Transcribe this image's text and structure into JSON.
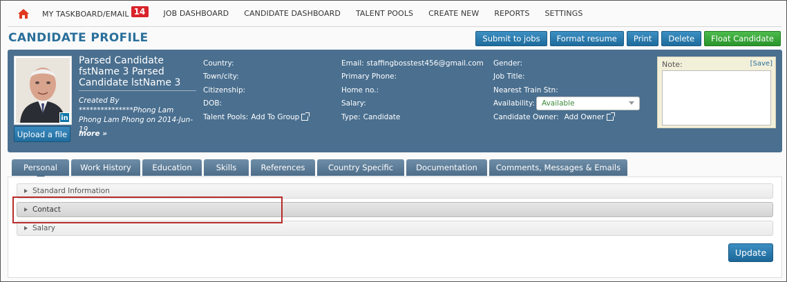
{
  "nav": {
    "items": [
      {
        "label": "MY TASKBOARD/EMAIL",
        "badge": "14"
      },
      {
        "label": "JOB DASHBOARD"
      },
      {
        "label": "CANDIDATE DASHBOARD"
      },
      {
        "label": "TALENT POOLS"
      },
      {
        "label": "CREATE NEW"
      },
      {
        "label": "REPORTS"
      },
      {
        "label": "SETTINGS"
      }
    ]
  },
  "page": {
    "title": "CANDIDATE PROFILE"
  },
  "actions": {
    "submit": "Submit to jobs",
    "format": "Format resume",
    "print": "Print",
    "delete": "Delete",
    "float": "Float Candidate"
  },
  "profile": {
    "name": "Parsed Candidate fstName 3 Parsed Candidate lstName 3",
    "created": "Created By ***************Phong Lam Phong Lam Phong on 2014-Jun-19",
    "more": "more »",
    "upload": "Upload a file",
    "linkedin": "in",
    "col1": {
      "country": "Country:",
      "town": "Town/city:",
      "citizenship": "Citizenship:",
      "dob": "DOB:",
      "talent_pools": "Talent Pools:",
      "add_to_group": "Add To Group"
    },
    "col2": {
      "email_label": "Email:",
      "email_value": "staffingbosstest456@gmail.com",
      "primary_phone": "Primary Phone:",
      "home_no": "Home no.:",
      "salary": "Salary:",
      "type_label": "Type:",
      "type_value": "Candidate"
    },
    "col3": {
      "gender": "Gender:",
      "job_title": "Job Title:",
      "nearest_train": "Nearest Train Stn:",
      "availability_label": "Availability:",
      "availability_value": "Available",
      "owner_label": "Candidate Owner:",
      "add_owner": "Add Owner"
    },
    "note": {
      "label": "Note:",
      "save": "[Save]"
    }
  },
  "tabs": [
    "Personal",
    "Work History",
    "Education",
    "Skills",
    "References",
    "Country Specific",
    "Documentation",
    "Comments, Messages & Emails"
  ],
  "sections": [
    "Standard Information",
    "Contact",
    "Salary"
  ],
  "update_label": "Update",
  "colors": {
    "brand": "#2a6f9a",
    "panel": "#4a6f8f",
    "badge": "#d9232a",
    "float": "#3aa93a",
    "highlight": "#b82a2a"
  }
}
